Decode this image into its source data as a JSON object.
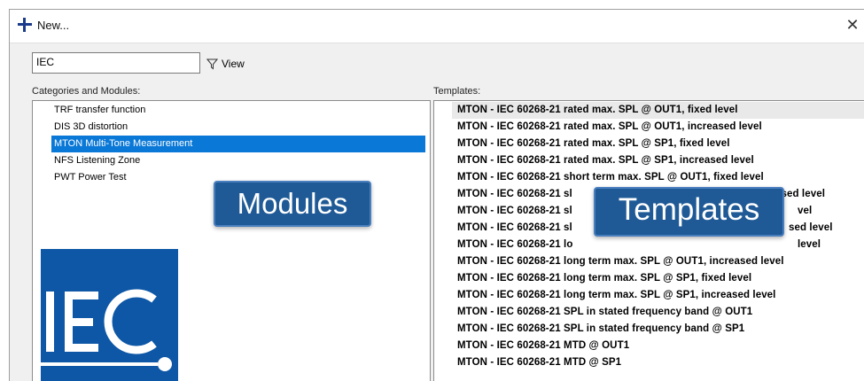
{
  "window": {
    "title": "New..."
  },
  "search": {
    "value": "IEC",
    "view_label": "View"
  },
  "categories": {
    "label": "Categories and Modules:",
    "items": [
      "TRF transfer function",
      "DIS 3D distortion",
      "MTON Multi-Tone Measurement",
      "NFS Listening Zone",
      "PWT Power Test"
    ],
    "selected_index": 2
  },
  "templates": {
    "label": "Templates:",
    "items": [
      "MTON - IEC 60268-21 rated max. SPL @ OUT1, fixed level",
      "MTON - IEC 60268-21 rated max. SPL @ OUT1, increased level",
      "MTON - IEC 60268-21 rated max. SPL @ SP1, fixed level",
      "MTON - IEC 60268-21 rated max. SPL @ SP1, increased level",
      "MTON - IEC 60268-21 short term max. SPL @ OUT1, fixed level",
      "MTON - IEC 60268-21 sl",
      "MTON - IEC 60268-21 sl",
      "MTON - IEC 60268-21 sl",
      "MTON - IEC 60268-21 lo",
      "MTON - IEC 60268-21 long term max. SPL @ OUT1, increased level",
      "MTON - IEC 60268-21 long term max. SPL @ SP1, fixed level",
      "MTON - IEC 60268-21 long term max. SPL @ SP1, increased level",
      "MTON - IEC 60268-21 SPL in stated frequency band @ OUT1",
      "MTON - IEC 60268-21 SPL in stated frequency band @ SP1",
      "MTON - IEC 60268-21 MTD @ OUT1",
      "MTON - IEC 60268-21 MTD @ SP1"
    ],
    "tails": [
      "ased level",
      "vel",
      "sed level",
      "level"
    ]
  },
  "callouts": {
    "modules": "Modules",
    "templates": "Templates"
  },
  "logo": {
    "text": "IEC"
  },
  "colors": {
    "selection": "#0a78d7",
    "callout": "#1f5a96",
    "logo": "#0d57a6"
  }
}
